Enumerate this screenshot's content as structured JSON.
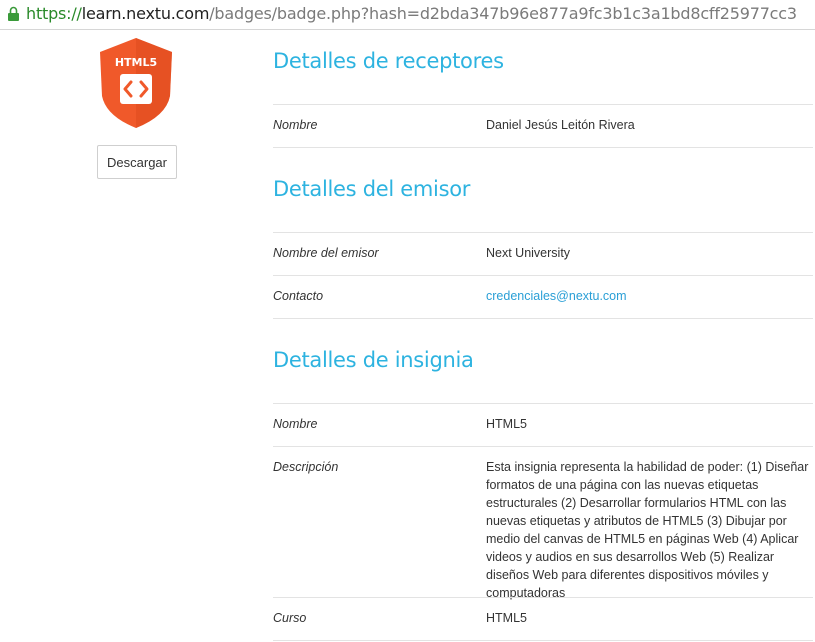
{
  "browser": {
    "url_scheme": "https://",
    "url_host": "learn.nextu.com",
    "url_path": "/badges/badge.php?hash=d2bda347b96e877a9fc3b1c3a1bd8cff25977cc3"
  },
  "badge": {
    "label": "HTML5",
    "download_label": "Descargar"
  },
  "recipient": {
    "title": "Detalles de receptores",
    "name_label": "Nombre",
    "name_value": "Daniel Jesús Leitón Rivera"
  },
  "issuer": {
    "title": "Detalles del emisor",
    "name_label": "Nombre del emisor",
    "name_value": "Next University",
    "contact_label": "Contacto",
    "contact_value": "credenciales@nextu.com"
  },
  "badge_details": {
    "title": "Detalles de insignia",
    "name_label": "Nombre",
    "name_value": "HTML5",
    "description_label": "Descripción",
    "description_value": "Esta insignia representa la habilidad de poder: (1) Diseñar formatos de una página con las nuevas etiquetas estructurales (2) Desarrollar formularios HTML con las nuevas etiquetas y atributos de HTML5 (3) Dibujar por medio del canvas de HTML5 en páginas Web (4) Aplicar videos y audios en sus desarrollos Web (5) Realizar diseños Web para diferentes dispositivos móviles y computadoras",
    "course_label": "Curso",
    "course_value": "HTML5"
  },
  "colors": {
    "accent": "#2db3e0",
    "badge_orange": "#f0592a",
    "secure_green": "#2a8a2a"
  }
}
